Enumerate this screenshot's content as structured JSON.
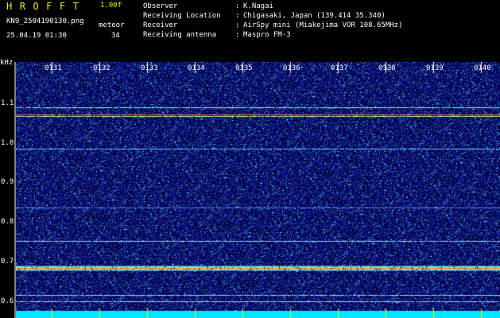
{
  "header": {
    "app_title": "HROFFT",
    "version": "1.00f",
    "filename": "KN9_2504190130.png",
    "datetime": "25.04.19 01:30",
    "meteor_label": "meteor",
    "meteor_count": "34"
  },
  "info": [
    {
      "key": "Observer",
      "value": "K.Nagai"
    },
    {
      "key": "Receiving Location",
      "value": "Chigasaki, Japan (139.414 35.340)"
    },
    {
      "key": "Receiver",
      "value": "AirSpy mini (Miakejima VOR 108.65MHz)"
    },
    {
      "key": "Receiving antenna",
      "value": "Maspro FM-3"
    }
  ],
  "spectrogram": {
    "frequency_unit": "kHz",
    "y_tick_labels": [
      "1.1",
      "1.0",
      "0.9",
      "0.8",
      "0.7",
      "0.6"
    ],
    "time_tick_labels": [
      "0131",
      "0132",
      "0133",
      "0134",
      "0135",
      "0136",
      "0137",
      "0138",
      "0139",
      "0140"
    ],
    "colors": {
      "background": "#000000",
      "noise_base": "#1a1e86",
      "text": "#ffffff",
      "title": "#f2ea00",
      "bottom_bar": "#00e8ff",
      "tick_marks": "#f2ea00"
    }
  }
}
